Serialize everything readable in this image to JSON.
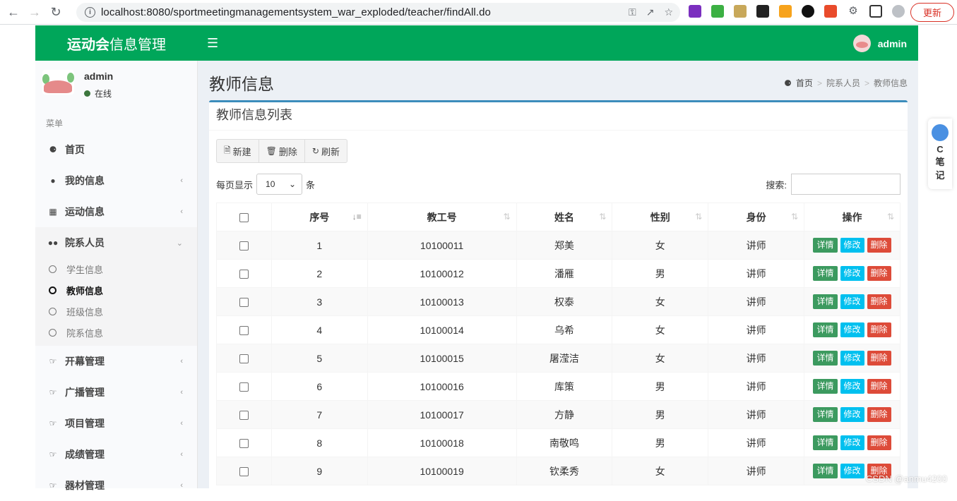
{
  "browser": {
    "url": "localhost:8080/sportmeetingmanagementsystem_war_exploded/teacher/findAll.do",
    "update_label": "更新"
  },
  "app": {
    "logo_bold": "运动会",
    "logo_rest": "信息管理",
    "top_user": "admin",
    "accent_color": "#00a65a"
  },
  "sidebar": {
    "user_name": "admin",
    "user_status": "在线",
    "menu_header": "菜单",
    "items": [
      {
        "label": "首页",
        "icon": "tachometer-icon"
      },
      {
        "label": "我的信息",
        "icon": "user-icon"
      },
      {
        "label": "运动信息",
        "icon": "bar-chart-icon"
      },
      {
        "label": "院系人员",
        "icon": "users-icon"
      },
      {
        "label": "开幕管理",
        "icon": "hand-point-icon"
      },
      {
        "label": "广播管理",
        "icon": "hand-point-icon"
      },
      {
        "label": "项目管理",
        "icon": "hand-point-icon"
      },
      {
        "label": "成绩管理",
        "icon": "hand-point-icon"
      },
      {
        "label": "器材管理",
        "icon": "hand-point-icon"
      }
    ],
    "submenu": [
      "学生信息",
      "教师信息",
      "班级信息",
      "院系信息"
    ]
  },
  "content": {
    "page_title": "教师信息",
    "breadcrumb": [
      "首页",
      "院系人员",
      "教师信息"
    ],
    "box_title": "教师信息列表",
    "toolbar": {
      "new": "新建",
      "delete": "删除",
      "refresh": "刷新"
    },
    "length_prefix": "每页显示",
    "length_value": "10",
    "length_suffix": "条",
    "search_label": "搜索:",
    "columns": [
      "序号",
      "教工号",
      "姓名",
      "性别",
      "身份",
      "操作"
    ],
    "actions": {
      "detail": "详情",
      "edit": "修改",
      "delete": "删除"
    },
    "rows": [
      {
        "no": "1",
        "id": "10100011",
        "name": "郑美",
        "gender": "女",
        "role": "讲师"
      },
      {
        "no": "2",
        "id": "10100012",
        "name": "潘雁",
        "gender": "男",
        "role": "讲师"
      },
      {
        "no": "3",
        "id": "10100013",
        "name": "权泰",
        "gender": "女",
        "role": "讲师"
      },
      {
        "no": "4",
        "id": "10100014",
        "name": "乌希",
        "gender": "女",
        "role": "讲师"
      },
      {
        "no": "5",
        "id": "10100015",
        "name": "屠滢洁",
        "gender": "女",
        "role": "讲师"
      },
      {
        "no": "6",
        "id": "10100016",
        "name": "库策",
        "gender": "男",
        "role": "讲师"
      },
      {
        "no": "7",
        "id": "10100017",
        "name": "方静",
        "gender": "男",
        "role": "讲师"
      },
      {
        "no": "8",
        "id": "10100018",
        "name": "南敬鸣",
        "gender": "男",
        "role": "讲师"
      },
      {
        "no": "9",
        "id": "10100019",
        "name": "钦柔秀",
        "gender": "女",
        "role": "讲师"
      }
    ]
  },
  "widget": {
    "label_1": "C",
    "label_2": "笔",
    "label_3": "记"
  },
  "watermark": "CSDN @anmu4200"
}
